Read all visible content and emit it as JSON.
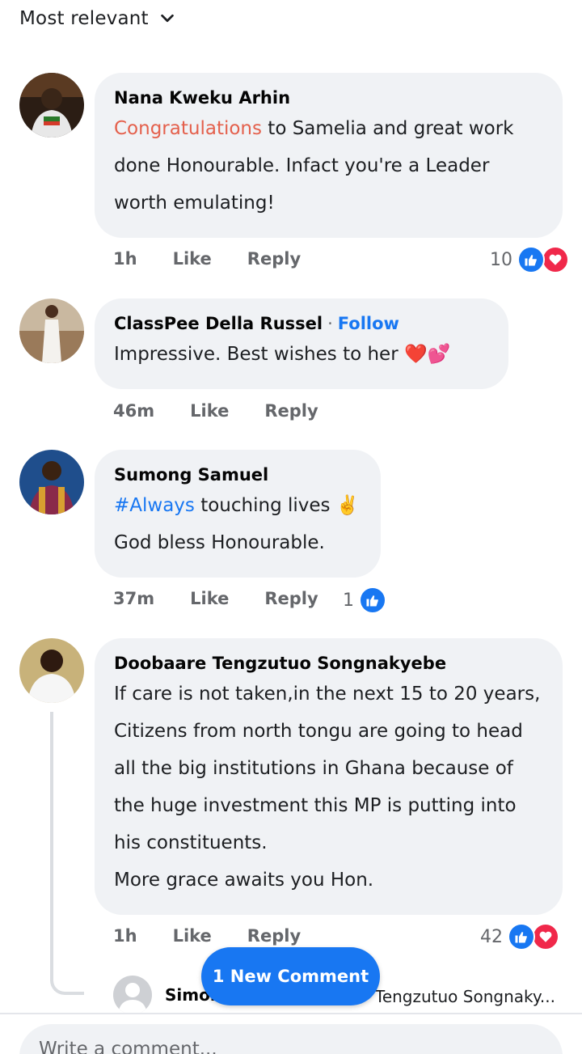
{
  "sort": {
    "label": "Most relevant"
  },
  "comments": [
    {
      "author": "Nana Kweku Arhin",
      "text_highlight": "Congratulations",
      "text": " to Samelia and great work done Honourable. Infact you're a Leader worth emulating!",
      "time": "1h",
      "like": "Like",
      "reply": "Reply",
      "reaction_count": "10"
    },
    {
      "author": "ClassPee Della Russel",
      "follow": "Follow",
      "text": "Impressive. Best wishes to her ❤️💕",
      "time": "46m",
      "like": "Like",
      "reply": "Reply"
    },
    {
      "author": "Sumong Samuel",
      "hashtag": "#Always",
      "text_line1": " touching lives ✌️",
      "text_line2": "God bless Honourable.",
      "time": "37m",
      "like": "Like",
      "reply": "Reply",
      "reaction_count": "1"
    },
    {
      "author": "Doobaare Tengzutuo Songnakyebe",
      "text": "If care is not taken,in the next 15 to 20 years, Citizens from north tongu are going to head all the big institutions in Ghana because of the huge investment this MP is putting into his constituents.",
      "text2": "More grace awaits you Hon.",
      "time": "1h",
      "like": "Like",
      "reply": "Reply",
      "reaction_count": "42"
    }
  ],
  "reply_preview": {
    "name": "Simon",
    "tail": "Tengzutuo Songnaky..."
  },
  "new_comment_button": "1 New Comment",
  "composer": {
    "placeholder": "Write a comment..."
  },
  "colors": {
    "accent": "#1877f2",
    "bubble": "#f0f2f5",
    "love": "#f0284a"
  }
}
